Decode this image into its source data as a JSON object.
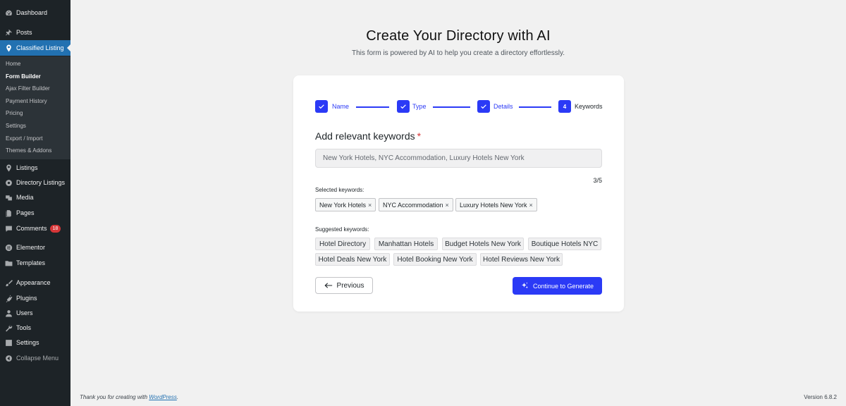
{
  "sidebar": {
    "items": [
      {
        "label": "Dashboard",
        "icon": "dashboard-icon"
      },
      {
        "label": "Posts",
        "icon": "pin-icon"
      },
      {
        "label": "Classified Listing",
        "icon": "map-pin-icon"
      },
      {
        "label": "Listings",
        "icon": "map-pin-icon"
      },
      {
        "label": "Directory Listings",
        "icon": "globe-icon"
      },
      {
        "label": "Media",
        "icon": "media-icon"
      },
      {
        "label": "Pages",
        "icon": "pages-icon"
      },
      {
        "label": "Comments",
        "icon": "comment-icon",
        "badge": "18"
      },
      {
        "label": "Elementor",
        "icon": "elementor-icon"
      },
      {
        "label": "Templates",
        "icon": "folder-icon"
      },
      {
        "label": "Appearance",
        "icon": "brush-icon"
      },
      {
        "label": "Plugins",
        "icon": "plug-icon"
      },
      {
        "label": "Users",
        "icon": "user-icon"
      },
      {
        "label": "Tools",
        "icon": "wrench-icon"
      },
      {
        "label": "Settings",
        "icon": "settings-icon"
      },
      {
        "label": "Collapse Menu",
        "icon": "collapse-icon"
      }
    ],
    "submenu": [
      {
        "label": "Home"
      },
      {
        "label": "Form Builder"
      },
      {
        "label": "Ajax Filter Builder"
      },
      {
        "label": "Payment History"
      },
      {
        "label": "Pricing"
      },
      {
        "label": "Settings"
      },
      {
        "label": "Export / Import"
      },
      {
        "label": "Themes & Addons"
      }
    ]
  },
  "header": {
    "title": "Create Your Directory with AI",
    "subtitle": "This form is powered by AI to help you create a directory effortlessly."
  },
  "steps": [
    {
      "label": "Name",
      "state": "done"
    },
    {
      "label": "Type",
      "state": "done"
    },
    {
      "label": "Details",
      "state": "done"
    },
    {
      "label": "Keywords",
      "state": "current",
      "number": "4"
    }
  ],
  "form": {
    "heading": "Add relevant keywords",
    "required_mark": "*",
    "placeholder": "New York Hotels, NYC Accommodation, Luxury Hotels New York",
    "counter": "3/5",
    "selected_label": "Selected keywords:",
    "selected": [
      "New York Hotels",
      "NYC Accommodation",
      "Luxury Hotels New York"
    ],
    "remove_glyph": "×",
    "suggested_label": "Suggested keywords:",
    "suggested": [
      "Hotel Directory",
      "Manhattan Hotels",
      "Budget Hotels New York",
      "Boutique Hotels NYC",
      "Hotel Deals New York",
      "Hotel Booking New York",
      "Hotel Reviews New York"
    ],
    "prev_label": "Previous",
    "next_label": "Continue to Generate"
  },
  "footer": {
    "thanks_prefix": "Thank you for creating with ",
    "thanks_link": "WordPress",
    "thanks_suffix": ".",
    "version": "Version 6.8.2"
  },
  "colors": {
    "accent": "#2b3af6",
    "sidebar_bg": "#1d2327",
    "sidebar_active": "#2271b1",
    "badge": "#d63638"
  }
}
